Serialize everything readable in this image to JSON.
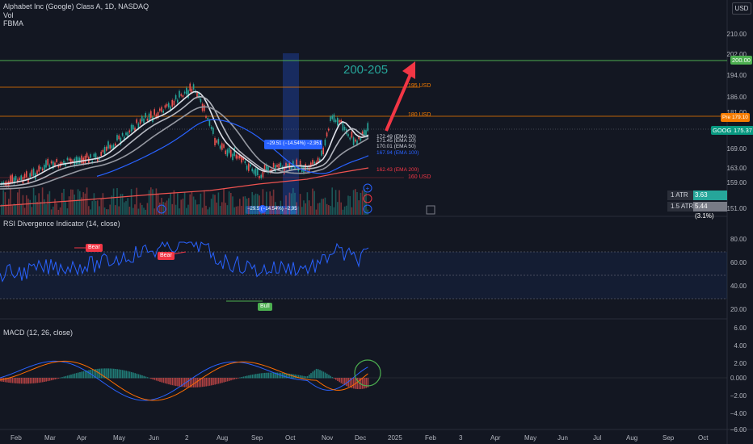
{
  "header": {
    "title": "Alphabet Inc (Google) Class A, 1D, NASDAQ",
    "indicator_1": "Vol",
    "indicator_2": "FBMA"
  },
  "currency_button": "USD",
  "price_axis": [
    "210.00",
    "202.00",
    "194.00",
    "186.00",
    "181.00",
    "169.00",
    "163.00",
    "159.00",
    "151.00"
  ],
  "price_tags": {
    "level_200": "200.00",
    "level_180": "179.10",
    "ticker": "GOOGL",
    "last_price": "175.37"
  },
  "annotations": {
    "target_zone": "200-205",
    "level_195_label": "195 USD",
    "level_180_label": "180 USD",
    "level_160_label": "160 USD",
    "ema_20": "172.49 (EMA 20)",
    "ema_10": "171.45 (EMA 10)",
    "ema_50": "170.01 (EMA 50)",
    "ema_100": "167.94 (EMA 100)",
    "ema_200": "162.43 (EMA 200)",
    "measure": "−29.51 (−14.54%) −2,951",
    "measure_small": "−29.5 (−14.54%) −2,95"
  },
  "atr_table": [
    {
      "label": "1 ATR",
      "value": "3.63 (2.07%)"
    },
    {
      "label": "1.5 ATR",
      "value": "5.44 (3.1%)"
    }
  ],
  "rsi": {
    "title": "RSI Divergence Indicator (14, close)",
    "axis": [
      "80.00",
      "60.00",
      "40.00",
      "20.00"
    ],
    "bear_label": "Bear",
    "bull_label": "Bull"
  },
  "macd": {
    "title": "MACD (12, 26, close)",
    "axis": [
      "6.00",
      "4.00",
      "2.00",
      "0.000",
      "−2.00",
      "−4.00",
      "−6.00"
    ]
  },
  "time_axis": [
    "Feb",
    "Mar",
    "Apr",
    "May",
    "Jun",
    "2",
    "Aug",
    "Sep",
    "Oct",
    "Nov",
    "Dec",
    "2025",
    "Feb",
    "3",
    "Apr",
    "May",
    "Jun",
    "Jul",
    "Aug",
    "Sep",
    "Oct"
  ],
  "colors": {
    "background": "#131722",
    "up": "#26a69a",
    "down": "#ef5350",
    "rsi_line": "#2962ff",
    "macd_line": "#2962ff",
    "signal_line": "#ff6d00",
    "level_green": "#4caf50",
    "level_orange": "#f57c00",
    "arrow": "#f23645"
  }
}
